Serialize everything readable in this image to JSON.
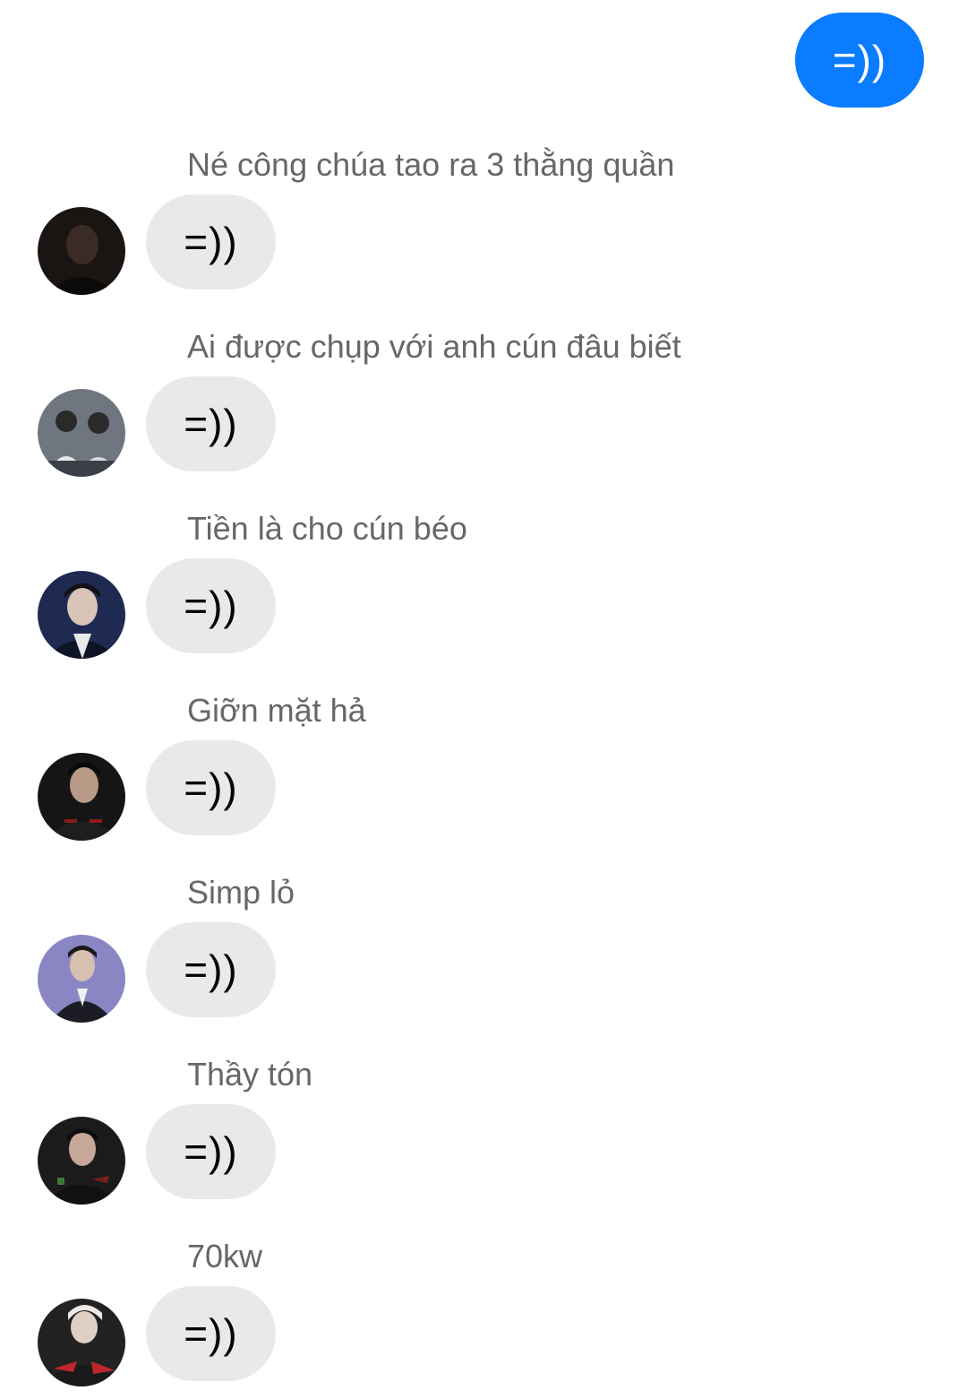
{
  "outgoing": {
    "text": "=))",
    "color": "#0a7cff"
  },
  "messages": [
    {
      "sender": "Né công chúa tao ra 3 thằng quần",
      "text": "=))",
      "avatar_bg": "#1a1512",
      "avatar_fg": "#3a2c24"
    },
    {
      "sender": "Ai được chụp với anh cún đâu biết",
      "text": "=))",
      "avatar_bg": "#6f7680",
      "avatar_fg": "#e8e8e8"
    },
    {
      "sender": "Tiền là cho cún béo",
      "text": "=))",
      "avatar_bg": "#1e2a52",
      "avatar_fg": "#d9c4b8"
    },
    {
      "sender": "Giỡn mặt hả",
      "text": "=))",
      "avatar_bg": "#151515",
      "avatar_fg": "#4a1c1c"
    },
    {
      "sender": "Simp lỏ",
      "text": "=))",
      "avatar_bg": "#8a86c4",
      "avatar_fg": "#1c1c26"
    },
    {
      "sender": "Thầy tón",
      "text": "=))",
      "avatar_bg": "#1b1b1b",
      "avatar_fg": "#3d7a3a"
    },
    {
      "sender": "70kw",
      "text": "=))",
      "avatar_bg": "#222222",
      "avatar_fg": "#c0262c"
    }
  ]
}
